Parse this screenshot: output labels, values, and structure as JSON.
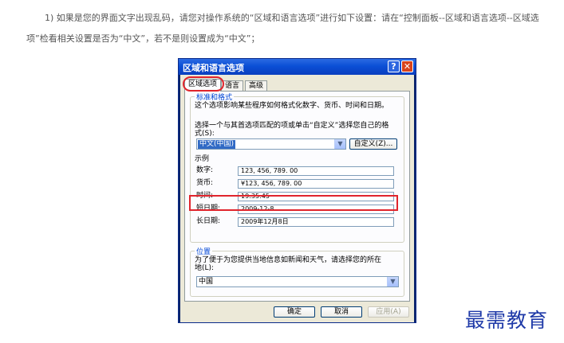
{
  "intro": {
    "line1": "1) 如果是您的界面文字出现乱码，请您对操作系统的“区域和语言选项”进行如下设置：请在“控制面板--区域和语言选项--区域选",
    "line2": "项”检看相关设置是否为“中文”，若不是则设置成为“中文”；"
  },
  "dialog": {
    "title": "区域和语言选项",
    "help_glyph": "?",
    "close_glyph": "✕",
    "tabs": [
      "区域选项",
      "语言",
      "高级"
    ],
    "standards": {
      "title": "标准和格式",
      "desc": "这个选项影响某些程序如何格式化数字、货币、时间和日期。",
      "choose_line1": "选择一个与其首选项匹配的项或单击“自定义”选择您自己的格",
      "choose_line2": "式(S):",
      "locale_value": "中文(中国)",
      "customize_label": "自定义(Z)...",
      "sample_title": "示例",
      "samples": [
        {
          "label": "数字:",
          "value": "123, 456, 789. 00"
        },
        {
          "label": "货币:",
          "value": "¥123, 456, 789. 00"
        },
        {
          "label": "时间:",
          "value": "19:35:45"
        },
        {
          "label": "短日期:",
          "value": "2009-12-8"
        },
        {
          "label": "长日期:",
          "value": "2009年12月8日"
        }
      ]
    },
    "location": {
      "title": "位置",
      "desc_line1": "为了便于为您提供当地信息如新闻和天气，请选择您的所在",
      "desc_line2": "地(L):",
      "value": "中国"
    },
    "buttons": {
      "ok": "确定",
      "cancel": "取消",
      "apply": "应用(A)"
    }
  },
  "watermark": "最需教育",
  "colors": {
    "highlight_red": "#e0242c",
    "title_blue": "#0b4fd6",
    "watermark_blue": "#1f3aa8"
  }
}
